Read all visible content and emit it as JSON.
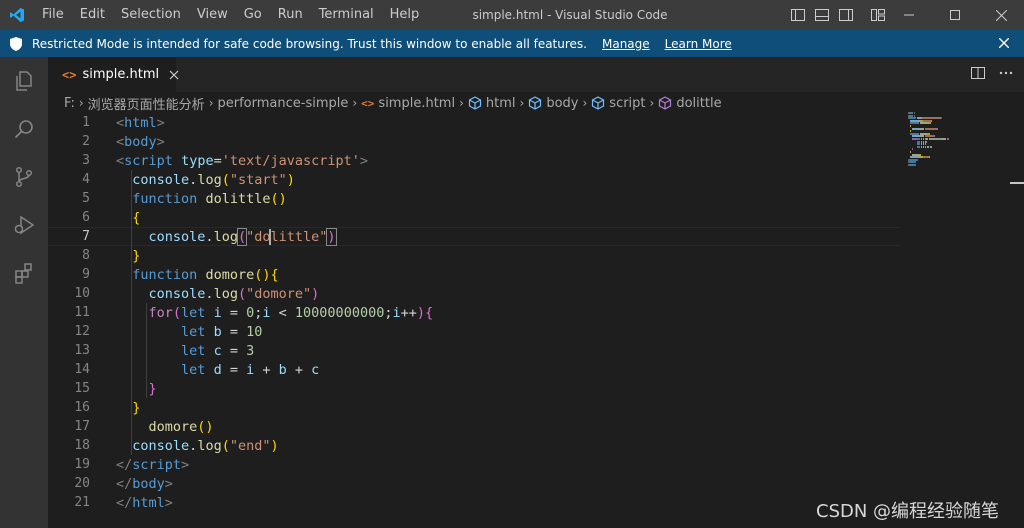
{
  "app": {
    "window_title": "simple.html - Visual Studio Code",
    "menu": [
      "File",
      "Edit",
      "Selection",
      "View",
      "Go",
      "Run",
      "Terminal",
      "Help"
    ],
    "accent_color": "#0e4e78"
  },
  "banner": {
    "message": "Restricted Mode is intended for safe code browsing. Trust this window to enable all features.",
    "manage_label": "Manage",
    "learn_more_label": "Learn More"
  },
  "activity_bar": {
    "icons": [
      "explorer-icon",
      "search-icon",
      "source-control-icon",
      "run-debug-icon",
      "extensions-icon"
    ]
  },
  "tabs": [
    {
      "label": "simple.html",
      "icon": "html-file-icon",
      "active": true
    }
  ],
  "breadcrumb": [
    {
      "label": "F:",
      "icon": ""
    },
    {
      "label": "浏览器页面性能分析",
      "icon": ""
    },
    {
      "label": "performance-simple",
      "icon": ""
    },
    {
      "label": "simple.html",
      "icon": "html-file-icon"
    },
    {
      "label": "html",
      "icon": "element-icon"
    },
    {
      "label": "body",
      "icon": "element-icon"
    },
    {
      "label": "script",
      "icon": "element-icon"
    },
    {
      "label": "dolittle",
      "icon": "function-icon"
    }
  ],
  "editor": {
    "active_line": 7,
    "line_numbers": [
      "1",
      "2",
      "3",
      "4",
      "5",
      "6",
      "7",
      "8",
      "9",
      "10",
      "11",
      "12",
      "13",
      "14",
      "15",
      "16",
      "17",
      "18",
      "19",
      "20",
      "21"
    ],
    "lines": [
      [
        [
          "t-tag",
          "<"
        ],
        [
          "t-tagname",
          "html"
        ],
        [
          "t-tag",
          ">"
        ]
      ],
      [
        [
          "t-tag",
          "<"
        ],
        [
          "t-tagname",
          "body"
        ],
        [
          "t-tag",
          ">"
        ]
      ],
      [
        [
          "t-tag",
          "<"
        ],
        [
          "t-tagname",
          "script"
        ],
        [
          "t-plain",
          " "
        ],
        [
          "t-attr",
          "type"
        ],
        [
          "t-plain",
          "="
        ],
        [
          "t-str",
          "'text/javascript'"
        ],
        [
          "t-tag",
          ">"
        ]
      ],
      [
        [
          "t-plain",
          "  "
        ],
        [
          "t-var",
          "console"
        ],
        [
          "t-plain",
          "."
        ],
        [
          "t-fn",
          "log"
        ],
        [
          "t-p1",
          "("
        ],
        [
          "t-str",
          "\"start\""
        ],
        [
          "t-p1",
          ")"
        ]
      ],
      [
        [
          "t-plain",
          "  "
        ],
        [
          "t-kw",
          "function"
        ],
        [
          "t-plain",
          " "
        ],
        [
          "t-fn",
          "dolittle"
        ],
        [
          "t-p1",
          "()"
        ]
      ],
      [
        [
          "t-plain",
          "  "
        ],
        [
          "t-p1",
          "{"
        ]
      ],
      [
        [
          "t-plain",
          "    "
        ],
        [
          "t-var",
          "console"
        ],
        [
          "t-plain",
          "."
        ],
        [
          "t-fn",
          "log"
        ],
        [
          "t-p2 bracket-match",
          "("
        ],
        [
          "t-str",
          "\"do"
        ],
        [
          "cursor",
          ""
        ],
        [
          "t-str",
          "little\""
        ],
        [
          "t-p2 bracket-match",
          ")"
        ]
      ],
      [
        [
          "t-plain",
          "  "
        ],
        [
          "t-p1",
          "}"
        ]
      ],
      [
        [
          "t-plain",
          "  "
        ],
        [
          "t-kw",
          "function"
        ],
        [
          "t-plain",
          " "
        ],
        [
          "t-fn",
          "domore"
        ],
        [
          "t-p1",
          "(){"
        ]
      ],
      [
        [
          "t-plain",
          "    "
        ],
        [
          "t-var",
          "console"
        ],
        [
          "t-plain",
          "."
        ],
        [
          "t-fn",
          "log"
        ],
        [
          "t-p2",
          "("
        ],
        [
          "t-str",
          "\"domore\""
        ],
        [
          "t-p2",
          ")"
        ]
      ],
      [
        [
          "t-plain",
          "    "
        ],
        [
          "t-ctl",
          "for"
        ],
        [
          "t-p2",
          "("
        ],
        [
          "t-kw",
          "let"
        ],
        [
          "t-plain",
          " "
        ],
        [
          "t-var",
          "i"
        ],
        [
          "t-plain",
          " = "
        ],
        [
          "t-num",
          "0"
        ],
        [
          "t-plain",
          ";"
        ],
        [
          "t-var",
          "i"
        ],
        [
          "t-plain",
          " < "
        ],
        [
          "t-num",
          "10000000000"
        ],
        [
          "t-plain",
          ";"
        ],
        [
          "t-var",
          "i"
        ],
        [
          "t-plain",
          "++"
        ],
        [
          "t-p2",
          ")"
        ],
        [
          "t-p2",
          "{"
        ]
      ],
      [
        [
          "t-plain",
          "        "
        ],
        [
          "t-kw",
          "let"
        ],
        [
          "t-plain",
          " "
        ],
        [
          "t-var",
          "b"
        ],
        [
          "t-plain",
          " = "
        ],
        [
          "t-num",
          "10"
        ]
      ],
      [
        [
          "t-plain",
          "        "
        ],
        [
          "t-kw",
          "let"
        ],
        [
          "t-plain",
          " "
        ],
        [
          "t-var",
          "c"
        ],
        [
          "t-plain",
          " = "
        ],
        [
          "t-num",
          "3"
        ]
      ],
      [
        [
          "t-plain",
          "        "
        ],
        [
          "t-kw",
          "let"
        ],
        [
          "t-plain",
          " "
        ],
        [
          "t-var",
          "d"
        ],
        [
          "t-plain",
          " = "
        ],
        [
          "t-var",
          "i"
        ],
        [
          "t-plain",
          " + "
        ],
        [
          "t-var",
          "b"
        ],
        [
          "t-plain",
          " + "
        ],
        [
          "t-var",
          "c"
        ]
      ],
      [
        [
          "t-plain",
          "    "
        ],
        [
          "t-p2",
          "}"
        ]
      ],
      [
        [
          "t-plain",
          "  "
        ],
        [
          "t-p1",
          "}"
        ]
      ],
      [
        [
          "t-plain",
          "    "
        ],
        [
          "t-fn",
          "domore"
        ],
        [
          "t-p1",
          "()"
        ]
      ],
      [
        [
          "t-plain",
          "  "
        ],
        [
          "t-var",
          "console"
        ],
        [
          "t-plain",
          "."
        ],
        [
          "t-fn",
          "log"
        ],
        [
          "t-p1",
          "("
        ],
        [
          "t-str",
          "\"end\""
        ],
        [
          "t-p1",
          ")"
        ]
      ],
      [
        [
          "t-tag",
          "</"
        ],
        [
          "t-tagname",
          "script"
        ],
        [
          "t-tag",
          ">"
        ]
      ],
      [
        [
          "t-tag",
          "</"
        ],
        [
          "t-tagname",
          "body"
        ],
        [
          "t-tag",
          ">"
        ]
      ],
      [
        [
          "t-tag",
          "</"
        ],
        [
          "t-tagname",
          "html"
        ],
        [
          "t-tag",
          ">"
        ]
      ]
    ]
  },
  "watermark": "CSDN @编程经验随笔"
}
